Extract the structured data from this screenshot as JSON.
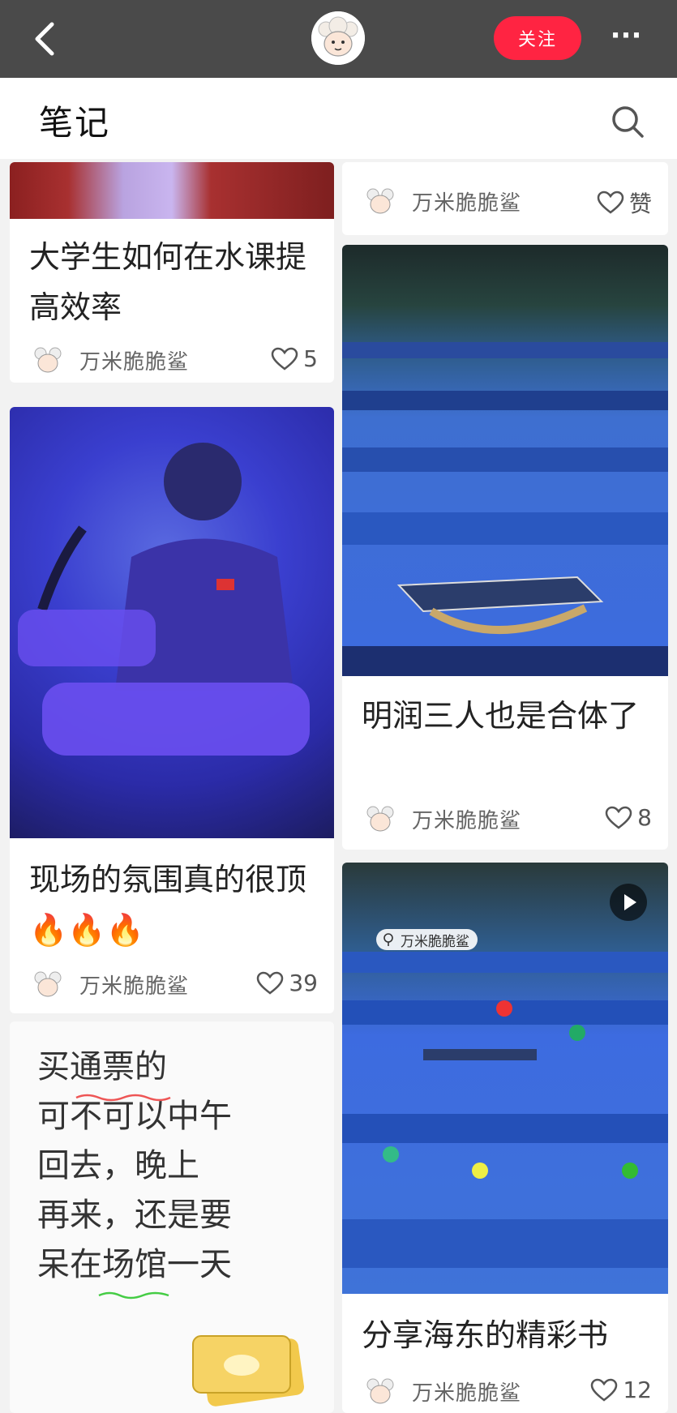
{
  "header": {
    "follow_label": "关注",
    "more_label": "···"
  },
  "section": {
    "title": "笔记"
  },
  "author": "万米脆脆鲨",
  "notes": [
    {
      "title": "大学生如何在水课提高效率",
      "likes": "5"
    },
    {
      "title": "现场的氛围真的很顶🔥🔥🔥",
      "likes": "39"
    },
    {
      "text_lines": [
        "买通票的",
        "可不可以中午",
        "回去，晚上",
        "再来，还是要",
        "呆在场馆一天"
      ]
    },
    {
      "likes": "赞"
    },
    {
      "title": "明润三人也是合体了",
      "likes": "8"
    },
    {
      "title": "分享海东的精彩书",
      "likes": "12",
      "watermark": "万米脆脆鲨"
    }
  ],
  "colors": {
    "topbar": "#4a4a4a",
    "accent": "#ff2442",
    "background": "#f2f2f2"
  }
}
